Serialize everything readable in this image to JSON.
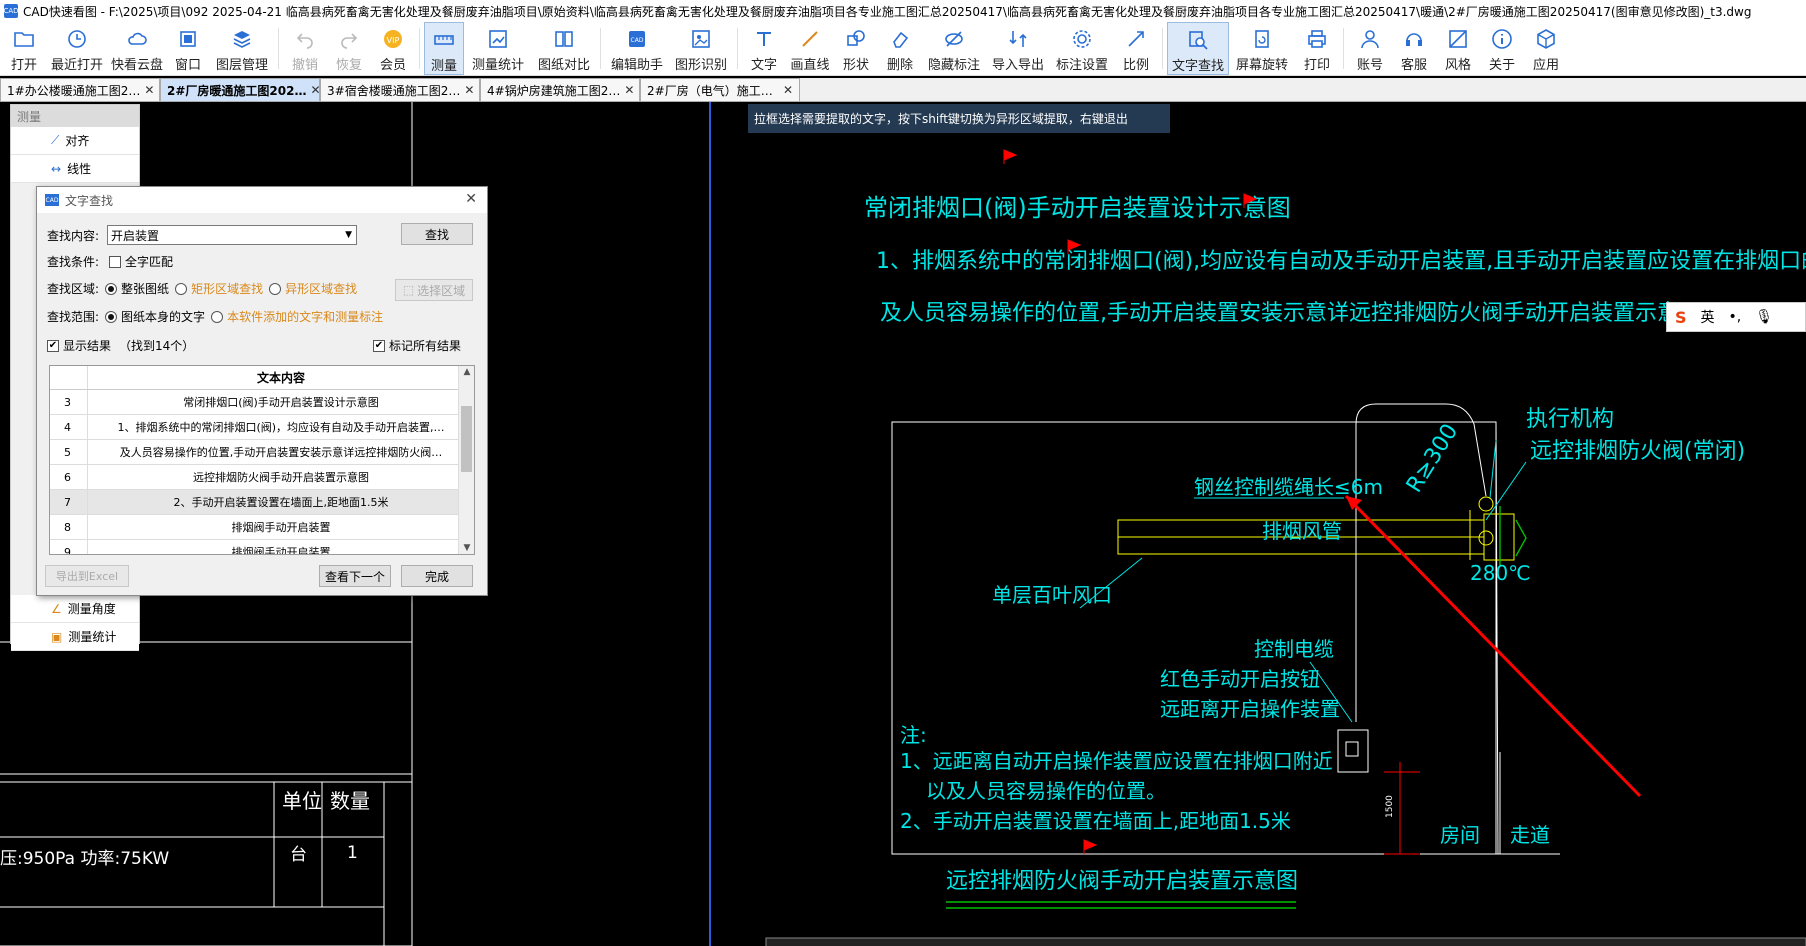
{
  "window": {
    "title": "CAD快速看图 - F:\\2025\\项目\\092 2025-04-21 临高县病死畜禽无害化处理及餐厨废弃油脂项目\\原始资料\\临高县病死畜禽无害化处理及餐厨废弃油脂项目各专业施工图汇总20250417\\临高县病死畜禽无害化处理及餐厨废弃油脂项目各专业施工图汇总20250417\\暖通\\2#厂房暖通施工图20250417(图审意见修改图)_t3.dwg",
    "icon": "app-icon"
  },
  "toolbar": [
    {
      "label": "打开",
      "icon": "folder-icon",
      "state": "normal"
    },
    {
      "label": "最近打开",
      "icon": "clock-icon",
      "state": "normal"
    },
    {
      "label": "快看云盘",
      "icon": "cloud-icon",
      "state": "normal"
    },
    {
      "label": "窗口",
      "icon": "window-icon",
      "state": "normal"
    },
    {
      "label": "图层管理",
      "icon": "layers-icon",
      "state": "normal"
    },
    {
      "label": "撤销",
      "icon": "undo-icon",
      "state": "disabled"
    },
    {
      "label": "恢复",
      "icon": "redo-icon",
      "state": "disabled"
    },
    {
      "label": "会员",
      "icon": "vip-icon",
      "state": "normal"
    },
    {
      "label": "测量",
      "icon": "ruler-icon",
      "state": "active"
    },
    {
      "label": "测量统计",
      "icon": "measure-stats-icon",
      "state": "normal"
    },
    {
      "label": "图纸对比",
      "icon": "compare-icon",
      "state": "normal"
    },
    {
      "label": "编辑助手",
      "icon": "edit-assistant-icon",
      "state": "normal"
    },
    {
      "label": "图形识别",
      "icon": "shape-recognize-icon",
      "state": "normal"
    },
    {
      "label": "文字",
      "icon": "text-icon",
      "state": "normal"
    },
    {
      "label": "画直线",
      "icon": "line-icon",
      "state": "normal"
    },
    {
      "label": "形状",
      "icon": "shape-icon",
      "state": "normal"
    },
    {
      "label": "删除",
      "icon": "eraser-icon",
      "state": "normal"
    },
    {
      "label": "隐藏标注",
      "icon": "hide-annotation-icon",
      "state": "normal"
    },
    {
      "label": "导入导出",
      "icon": "import-export-icon",
      "state": "normal"
    },
    {
      "label": "标注设置",
      "icon": "annotation-settings-icon",
      "state": "normal"
    },
    {
      "label": "比例",
      "icon": "scale-icon",
      "state": "normal"
    },
    {
      "label": "文字查找",
      "icon": "text-search-icon",
      "state": "active"
    },
    {
      "label": "屏幕旋转",
      "icon": "rotate-icon",
      "state": "normal"
    },
    {
      "label": "打印",
      "icon": "printer-icon",
      "state": "normal"
    },
    {
      "label": "账号",
      "icon": "user-icon",
      "state": "normal"
    },
    {
      "label": "客服",
      "icon": "headset-icon",
      "state": "normal"
    },
    {
      "label": "风格",
      "icon": "style-icon",
      "state": "normal"
    },
    {
      "label": "关于",
      "icon": "info-icon",
      "state": "normal"
    },
    {
      "label": "应用",
      "icon": "apps-icon",
      "state": "normal"
    }
  ],
  "tabs": [
    {
      "label": "1#办公楼暖通施工图2…",
      "active": false
    },
    {
      "label": "2#厂房暖通施工图202…",
      "active": true
    },
    {
      "label": "3#宿舍楼暖通施工图2…",
      "active": false
    },
    {
      "label": "4#锅炉房建筑施工图2…",
      "active": false
    },
    {
      "label": "2#厂房（电气）施工…",
      "active": false
    }
  ],
  "tab_close": "✕",
  "hint": "拉框选择需要提取的文字，按下shift键切换为异形区域提取，右键退出",
  "ime": {
    "logo": "S",
    "lang": "英"
  },
  "measure_panel": {
    "header": "测量",
    "items": [
      "对齐",
      "线性"
    ],
    "bottom_items": [
      "测量角度",
      "测量统计"
    ]
  },
  "find_dialog": {
    "title": "文字查找",
    "search_label": "查找内容:",
    "search_value": "开启装置",
    "find_button": "查找",
    "condition_label": "查找条件:",
    "whole_word": "全字匹配",
    "area_label": "查找区域:",
    "area_options": [
      "整张图纸",
      "矩形区域查找",
      "异形区域查找"
    ],
    "select_area_button": "选择区域",
    "scope_label": "查找范围:",
    "scope_options": [
      "图纸本身的文字",
      "本软件添加的文字和测量标注"
    ],
    "show_results": "显示结果",
    "result_count": "（找到14个）",
    "mark_all": "标记所有结果",
    "column_header": "文本内容",
    "rows": [
      {
        "n": "3",
        "text": "常闭排烟口(阀)手动开启装置设计示意图"
      },
      {
        "n": "4",
        "text": "1、排烟系统中的常闭排烟口(阀)，均应设有自动及手动开启装置,…"
      },
      {
        "n": "5",
        "text": "及人员容易操作的位置,手动开启装置安装示意详远控排烟防火阀…"
      },
      {
        "n": "6",
        "text": "远控排烟防火阀手动开启装置示意图"
      },
      {
        "n": "7",
        "text": "2、手动开启装置设置在墙面上,距地面1.5米"
      },
      {
        "n": "8",
        "text": "排烟阀手动开启装置"
      },
      {
        "n": "9",
        "text": "排烟阀手动开启装置"
      }
    ],
    "export_button": "导出到Excel",
    "next_button": "查看下一个",
    "done_button": "完成"
  },
  "drawing": {
    "title": "常闭排烟口(阀)手动开启装置设计示意图",
    "note1_line1": "1、排烟系统中的常闭排烟口(阀),均应设有自动及手动开启装置,且手动开启装置应设置在排烟口的附近以",
    "note1_line2": "及人员容易操作的位置,手动开启装置安装示意详远控排烟防火阀手动开启装置示意图。",
    "label_actuator": "执行机构",
    "label_damper": "远控排烟防火阀(常闭)",
    "label_radius": "R≥300",
    "label_cable": "钢丝控制缆绳长≤6m",
    "label_duct": "排烟风管",
    "label_temp": "280℃",
    "label_louver": "单层百叶风口",
    "label_control_cable": "控制电缆",
    "label_red_button": "红色手动开启按钮",
    "label_remote_device": "远距离开启操作装置",
    "notes_head": "注:",
    "notes_1a": "1、远距离自动开启操作装置应设置在排烟口附近",
    "notes_1b": "以及人员容易操作的位置。",
    "notes_2": "2、手动开启装置设置在墙面上,距地面1.5米",
    "dim_1500": "1500",
    "label_room": "房间",
    "label_corridor": "走道",
    "sub_title": "远控排烟防火阀手动开启装置示意图",
    "table_unit": "单位",
    "table_qty": "数量",
    "table_spec": "压:950Pa     功率:75KW",
    "table_unit_val": "台",
    "table_qty_val": "1",
    "colors": {
      "cad_cyan": "#00e5e5",
      "cad_white": "#ffffff",
      "cad_red": "#ff0000",
      "cad_green": "#00c000",
      "cad_yellow": "#ffff00"
    }
  }
}
